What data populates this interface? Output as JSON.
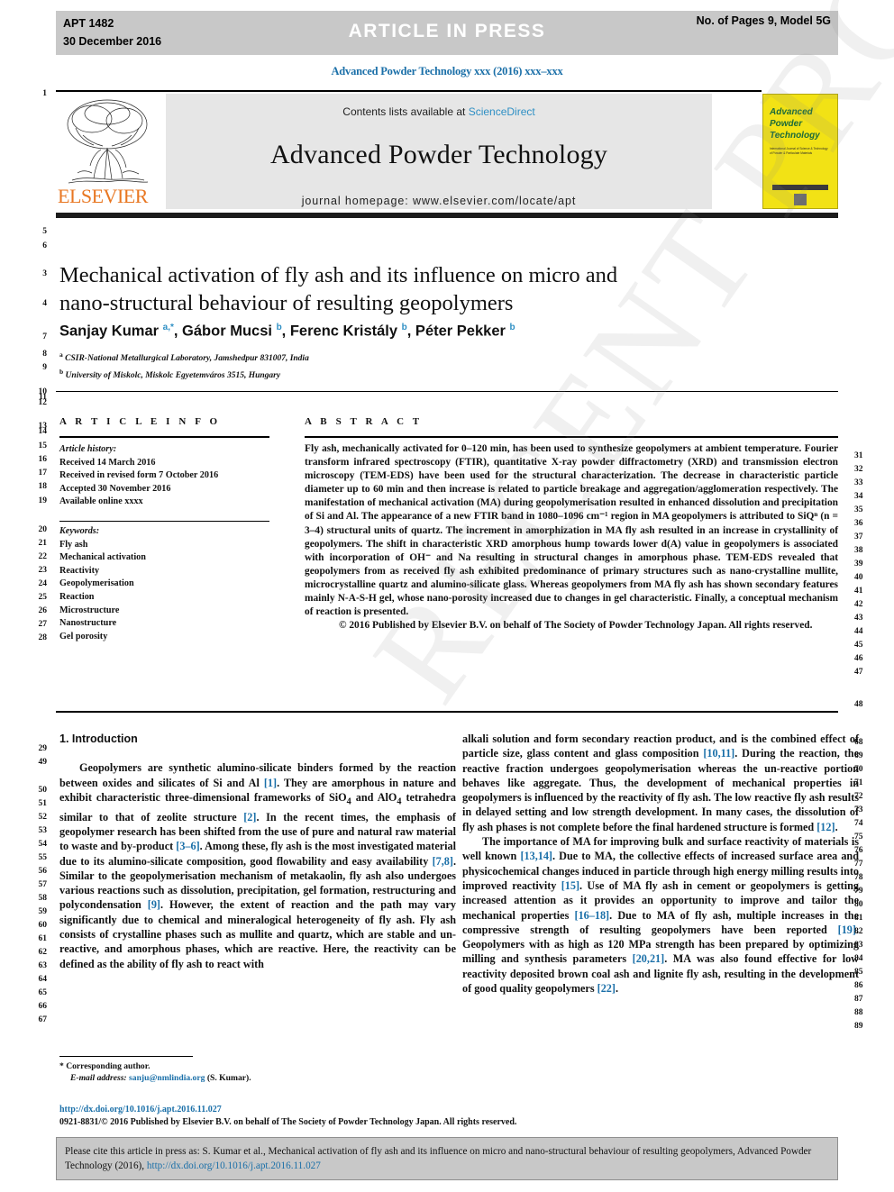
{
  "banner": {
    "article_id": "APT 1482",
    "date": "30 December 2016",
    "center": "ARTICLE  IN  PRESS",
    "pages_model": "No. of Pages 9, Model 5G"
  },
  "running_head": "Advanced Powder Technology xxx (2016) xxx–xxx",
  "masthead": {
    "contents_prefix": "Contents lists available at ",
    "sciencedirect": "ScienceDirect",
    "journal_title": "Advanced Powder Technology",
    "homepage": "journal homepage: www.elsevier.com/locate/apt",
    "publisher_logo": "ELSEVIER",
    "cover": {
      "title": "Advanced\nPowder\nTechnology",
      "subtitle": "International Journal of Science & Technology of Powder & Particulate Materials"
    }
  },
  "article": {
    "title": "Mechanical activation of fly ash and its influence on micro and nano-structural behaviour of resulting geopolymers",
    "authors_html": "Sanjay Kumar <sup>a,*</sup>, Gábor Mucsi <sup>b</sup>, Ferenc Kristály <sup>b</sup>, Péter Pekker <sup>b</sup>",
    "affiliation_a": "CSIR-National Metallurgical Laboratory, Jamshedpur 831007, India",
    "affiliation_b": "University of Miskolc, Miskolc Egyetemváros 3515, Hungary"
  },
  "info": {
    "heading": "A R T I C L E    I N F O",
    "history_label": "Article history:",
    "history": [
      "Received 14 March 2016",
      "Received in revised form 7 October 2016",
      "Accepted 30 November 2016",
      "Available online xxxx"
    ],
    "keywords_label": "Keywords:",
    "keywords": [
      "Fly ash",
      "Mechanical activation",
      "Reactivity",
      "Geopolymerisation",
      "Reaction",
      "Microstructure",
      "Nanostructure",
      "Gel porosity"
    ]
  },
  "abstract": {
    "heading": "A B S T R A C T",
    "body": "Fly ash, mechanically activated for 0–120 min, has been used to synthesize geopolymers at ambient temperature. Fourier transform infrared spectroscopy (FTIR), quantitative X-ray powder diffractometry (XRD) and transmission electron microscopy (TEM-EDS) have been used for the structural characterization. The decrease in characteristic particle diameter up to 60 min and then increase is related to particle breakage and aggregation/agglomeration respectively. The manifestation of mechanical activation (MA) during geopolymerisation resulted in enhanced dissolution and precipitation of Si and Al. The appearance of a new FTIR band in 1080–1096 cm⁻¹ region in MA geopolymers is attributed to SiQⁿ (n = 3–4) structural units of quartz. The increment in amorphization in MA fly ash resulted in an increase in crystallinity of geopolymers. The shift in characteristic XRD amorphous hump towards lower d(A) value in geopolymers is associated with incorporation of OH⁻ and Na resulting in structural changes in amorphous phase. TEM-EDS revealed that geopolymers from as received fly ash exhibited predominance of primary structures such as nano-crystalline mullite, microcrystalline quartz and alumino-silicate glass. Whereas geopolymers from MA fly ash has shown secondary features mainly N-A-S-H gel, whose nano-porosity increased due to changes in gel characteristic. Finally, a conceptual mechanism of reaction is presented.",
    "copyright": "© 2016 Published by Elsevier B.V. on behalf of The Society of Powder Technology Japan. All rights reserved."
  },
  "introduction": {
    "heading": "1. Introduction",
    "left_paragraph_1_parts": [
      "Geopolymers are synthetic alumino-silicate binders formed by the reaction between oxides and silicates of Si and Al ",
      "[1]",
      ". They are amorphous in nature and exhibit characteristic three-dimensional frameworks of SiO",
      "4",
      " and AlO",
      "4",
      " tetrahedra similar to that of zeolite structure ",
      "[2]",
      ". In the recent times, the emphasis of geopolymer research has been shifted from the use of pure and natural raw material to waste and by-product ",
      "[3–6]",
      ". Among these, fly ash is the most investigated material due to its alumino-silicate composition, good flowability and easy availability ",
      "[7,8]",
      ". Similar to the geopolymerisation mechanism of metakaolin, fly ash also undergoes various reactions such as dissolution, precipitation, gel formation, restructuring and polycondensation ",
      "[9]",
      ". However, the extent of reaction and the path may vary significantly due to chemical and mineralogical heterogeneity of fly ash. Fly ash consists of crystalline phases such as mullite and quartz, which are stable and un-reactive, and amorphous phases, which are reactive. Here, the reactivity can be defined as the ability of fly ash to react with"
    ],
    "right_paragraph_1_parts": [
      "alkali solution and form secondary reaction product, and is the combined effect of particle size, glass content and glass composition ",
      "[10,11]",
      ". During the reaction, the reactive fraction undergoes geopolymerisation whereas the un-reactive portion behaves like aggregate. Thus, the development of mechanical properties in geopolymers is influenced by the reactivity of fly ash. The low reactive fly ash results in delayed setting and low strength development. In many cases, the dissolution of fly ash phases is not complete before the final hardened structure is formed ",
      "[12]",
      "."
    ],
    "right_paragraph_2_parts": [
      "The importance of MA for improving bulk and surface reactivity of materials is well known ",
      "[13,14]",
      ". Due to MA, the collective effects of increased surface area and physicochemical changes induced in particle through high energy milling results into improved reactivity ",
      "[15]",
      ". Use of MA fly ash in cement or geopolymers is getting increased attention as it provides an opportunity to improve and tailor the mechanical properties ",
      "[16–18]",
      ". Due to MA of fly ash, multiple increases in the compressive strength of resulting geopolymers have been reported ",
      "[19]",
      ". Geopolymers with as high as 120 MPa strength has been prepared by optimizing milling and synthesis parameters ",
      "[20,21]",
      ". MA was also found effective for low reactivity deposited brown coal ash and lignite fly ash, resulting in the development of good quality geopolymers ",
      "[22]",
      "."
    ]
  },
  "footnote": {
    "corresponding_marker": "*",
    "corresponding_author": "Corresponding author.",
    "email_label": "E-mail address:",
    "email": "sanju@nmlindia.org",
    "email_owner": "(S. Kumar)."
  },
  "doi_block": {
    "doi_url": "http://dx.doi.org/10.1016/j.apt.2016.11.027",
    "issn_line": "0921-8831/© 2016 Published by Elsevier B.V. on behalf of The Society of Powder Technology Japan. All rights reserved."
  },
  "cite_box": {
    "text_before_link": "Please cite this article in press as: S. Kumar et al., Mechanical activation of fly ash and its influence on micro and nano-structural behaviour of resulting geopolymers, Advanced Powder Technology (2016), ",
    "link": "http://dx.doi.org/10.1016/j.apt.2016.11.027"
  },
  "watermark": "RECENT PROOF",
  "line_numbers": {
    "left": [
      "1",
      "5",
      "6",
      "3",
      "4",
      "7",
      "8",
      "9",
      "10",
      "11",
      "12",
      "13",
      "14",
      "15",
      "16",
      "17",
      "18",
      "19",
      "20",
      "21",
      "22",
      "23",
      "24",
      "25",
      "26",
      "27",
      "28",
      "29",
      "49",
      "50",
      "51",
      "52",
      "53",
      "54",
      "55",
      "56",
      "57",
      "58",
      "59",
      "60",
      "61",
      "62",
      "63",
      "64",
      "65",
      "66",
      "67"
    ],
    "right": [
      "31",
      "32",
      "33",
      "34",
      "35",
      "36",
      "37",
      "38",
      "39",
      "40",
      "41",
      "42",
      "43",
      "44",
      "45",
      "46",
      "47",
      "48",
      "68",
      "69",
      "70",
      "71",
      "72",
      "73",
      "74",
      "75",
      "76",
      "77",
      "78",
      "79",
      "80",
      "81",
      "82",
      "83",
      "84",
      "85",
      "86",
      "87",
      "88",
      "89"
    ]
  },
  "colors": {
    "link": "#1a6fa8",
    "banner_bg": "#c8c8c8",
    "masthead_bg": "#e6e6e6",
    "elsevier_orange": "#e87722",
    "cover_yellow": "#f2e215"
  }
}
